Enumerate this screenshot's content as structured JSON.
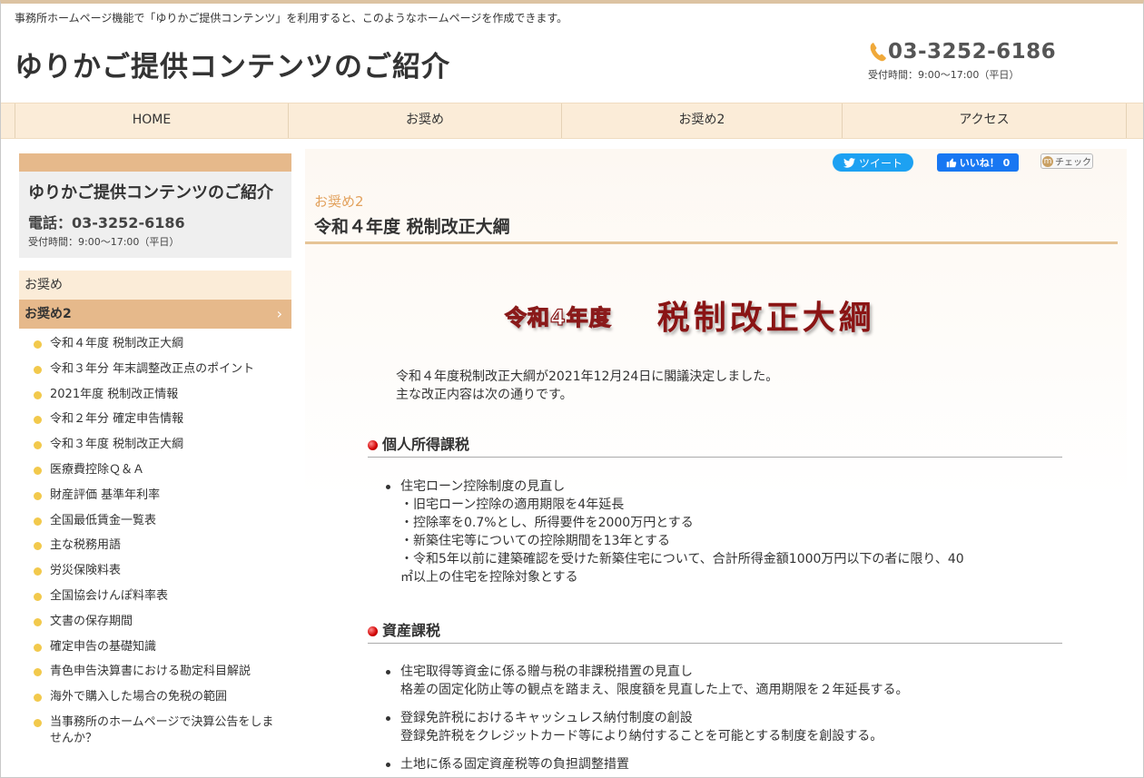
{
  "header": {
    "tagline": "事務所ホームページ機能で「ゆりかご提供コンテンツ」を利用すると、このようなホームページを作成できます。",
    "site_title": "ゆりかご提供コンテンツのご紹介",
    "phone": "03-3252-6186",
    "hours": "受付時間：9:00～17:00（平日）"
  },
  "nav": [
    {
      "label": "HOME"
    },
    {
      "label": "お奨め"
    },
    {
      "label": "お奨め2"
    },
    {
      "label": "アクセス"
    }
  ],
  "sidebar": {
    "card_title": "ゆりかご提供コンテンツのご紹介",
    "card_phone": "電話：03-3252-6186",
    "card_hours": "受付時間：9:00～17:00（平日）",
    "menu1": "お奨め",
    "menu2": "お奨め2",
    "chevron": "›",
    "items": [
      {
        "label": "令和４年度 税制改正大綱"
      },
      {
        "label": "令和３年分 年末調整改正点のポイント"
      },
      {
        "label": "2021年度 税制改正情報"
      },
      {
        "label": "令和２年分 確定申告情報"
      },
      {
        "label": "令和３年度 税制改正大綱"
      },
      {
        "label": "医療費控除Ｑ＆Ａ"
      },
      {
        "label": "財産評価 基準年利率"
      },
      {
        "label": "全国最低賃金一覧表"
      },
      {
        "label": "主な税務用語"
      },
      {
        "label": "労災保険料表"
      },
      {
        "label": "全国協会けんぽ料率表"
      },
      {
        "label": "文書の保存期間"
      },
      {
        "label": "確定申告の基礎知識"
      },
      {
        "label": "青色申告決算書における勘定科目解説"
      },
      {
        "label": "海外で購入した場合の免税の範囲"
      },
      {
        "label": "当事務所のホームページで決算公告をしませんか？"
      }
    ]
  },
  "share": {
    "tweet": "ツイート",
    "fb": "いいね！ 0",
    "mixi": "チェック"
  },
  "main": {
    "breadcrumb": "お奨め2",
    "title": "令和４年度 税制改正大綱",
    "banner_small": "令和4年度",
    "banner_big": "税制改正大綱",
    "intro1": "令和４年度税制改正大綱が2021年12月24日に閣議決定しました。",
    "intro2": "主な改正内容は次の通りです。",
    "section1": {
      "heading": "個人所得課税",
      "item_title": "住宅ローン控除制度の見直し",
      "lines": [
        "・旧宅ローン控除の適用期限を4年延長",
        "・控除率を0.7%とし、所得要件を2000万円とする",
        "・新築住宅等についての控除期間を13年とする",
        "・令和5年以前に建築確認を受けた新築住宅について、合計所得金額1000万円以下の者に限り、40",
        "㎡以上の住宅を控除対象とする"
      ]
    },
    "section2": {
      "heading": "資産課税",
      "items": [
        {
          "title": "住宅取得等資金に係る贈与税の非課税措置の見直し",
          "desc": "格差の固定化防止等の観点を踏まえ、限度額を見直した上で、適用期限を２年延長する。"
        },
        {
          "title": "登録免許税におけるキャッシュレス納付制度の創設",
          "desc": "登録免許税をクレジットカード等により納付することを可能とする制度を創設する。"
        },
        {
          "title": "土地に係る固定資産税等の負担調整措置",
          "desc": ""
        }
      ]
    }
  }
}
